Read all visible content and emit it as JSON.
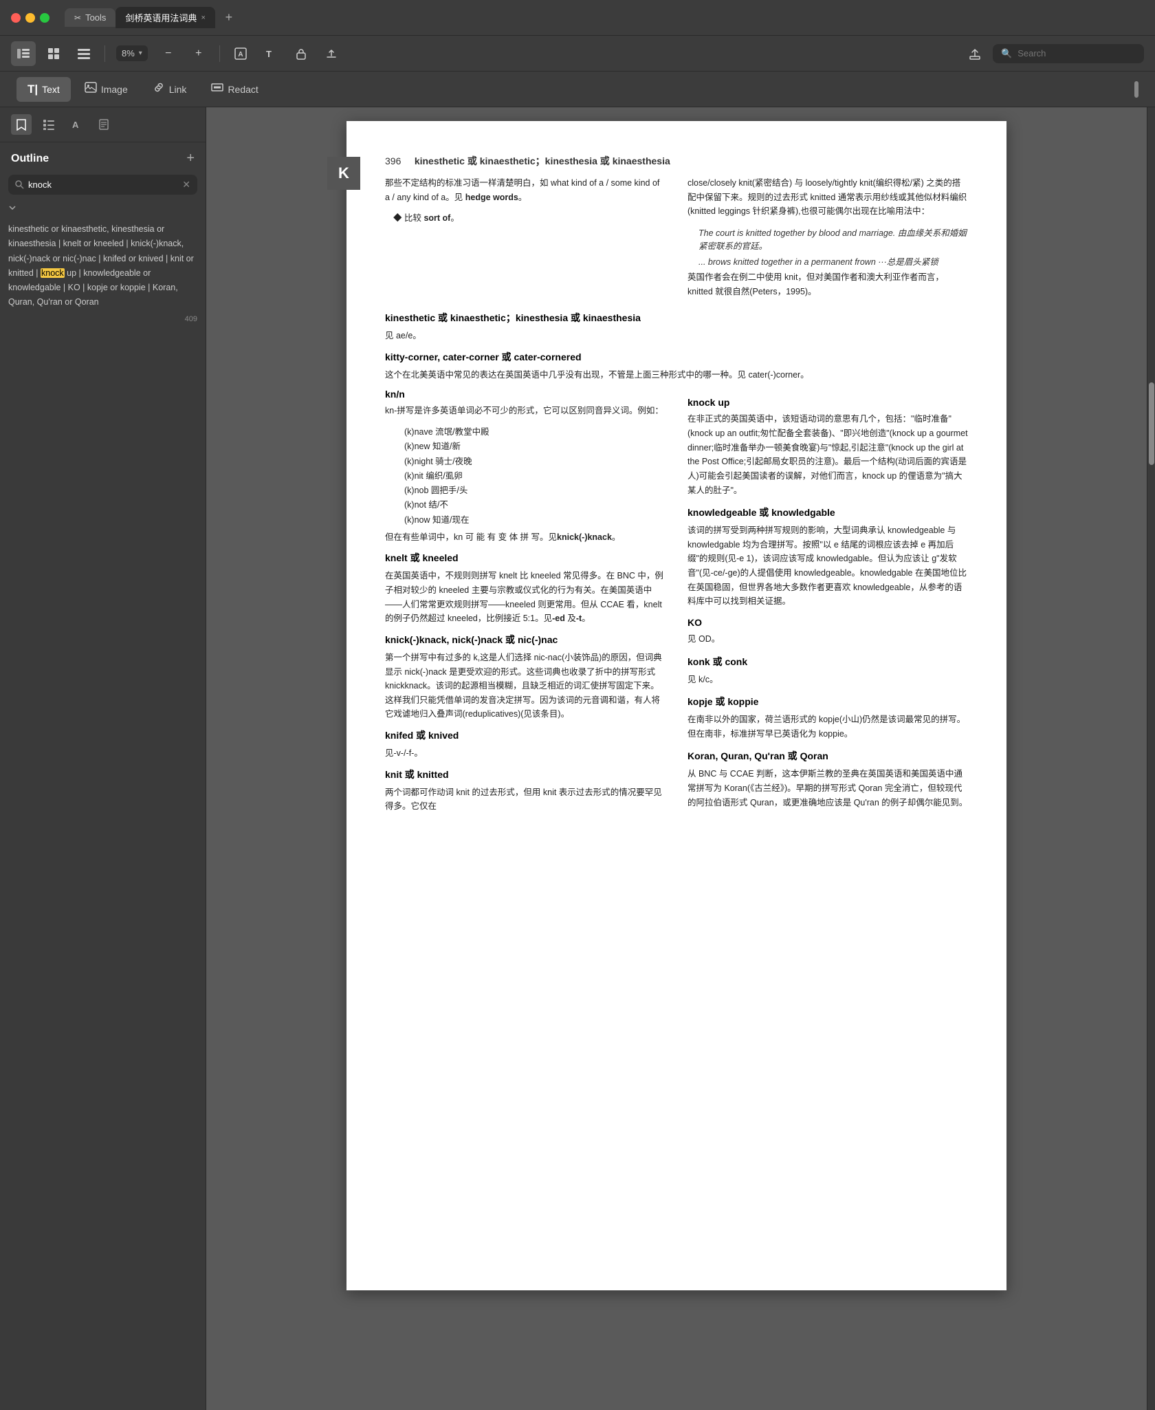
{
  "window": {
    "title": "剑桥英语用法词典",
    "tools_tab": "Tools",
    "close_btn": "×",
    "add_tab": "+"
  },
  "toolbar": {
    "zoom_value": "8%",
    "search_placeholder": "Search",
    "zoom_minus": "−",
    "zoom_plus": "+"
  },
  "toolbar2": {
    "text_label": "Text",
    "image_label": "Image",
    "link_label": "Link",
    "redact_label": "Redact"
  },
  "sidebar": {
    "title": "Outline",
    "search_placeholder": "knock",
    "outline_text": "kinesthetic or kinaesthetic, kinesthesia or kinaesthesia | knelt or kneeled | knick(-)knack, nick(-)nack or nic(-)nac | knifed or knived | knit or knitted | knock up | knowledgeable or knowledgable | KO | kopje or koppie | Koran, Quran, Qu'ran or Qoran",
    "page_num": "409"
  },
  "page": {
    "page_num_heading": "396",
    "section1_title": "kinesthetic 或 kinaesthetic；kinesthesia 或 kinaesthesia",
    "section1_col1_p1": "那些不定结构的标准习语一样清楚明白，如 what kind of a / some kind of a / any kind of a。见 hedge words。",
    "section1_col1_p2": "◆ 比较 sort of。",
    "section1_col2_p1": "close/closely knit(紧密结合) 与 loosely/tightly knit(编织得松/紧) 之类的搭配中保留下来。规则的过去形式 knitted 通常表示用纱线或其他似材料编织(knitted leggings 针织紧身裤),也很可能偶尔出现在比喻用法中：",
    "section1_col2_italic1": "The court is knitted together by blood and marriage. 由血缘关系和婚姻紧密联系的官廷。",
    "section1_col2_italic2": "... brows knitted together in a permanent frown ···总是眉头紧锁",
    "section1_col2_p2": "英国作者会在例二中使用 knit，但对美国作者和澳大利亚作者而言，knitted 就很自然(Peters，1995)。",
    "section2_title": "kinesthetic 或 kinaesthetic；kinesthesia 或 kinaesthesia",
    "section2_sub": "见 ae/e。",
    "section3_title": "kitty-corner, cater-corner 或 cater-cornered",
    "section3_body": "这个在北美英语中常见的表达在英国英语中几乎没有出现，不管是上面三种形式中的哪一种。见 cater(-)corner。",
    "section4_title": "kn/n",
    "section4_p1": "kn-拼写是许多英语单词必不可少的形式，它可以区别同音异义词。例如：",
    "kn_list": [
      "(k)nave 流氓/教堂中殿",
      "(k)new 知道/新",
      "(k)night 骑士/夜晚",
      "(k)nit 编织/虱卵",
      "(k)nob 圆把手/头",
      "(k)not 结/不",
      "(k)now 知道/现在"
    ],
    "section4_p2": "但在有些单词中，kn 可能有变体拼写。见knick(-)knack。",
    "section5_title": "knelt 或 kneeled",
    "section5_body": "在英国英语中，不规则则拼写 knelt 比 kneeled 常见得多。在 BNC 中，例子相对较少的 kneeled 主要与宗教或仪式化的行为有关。在美国英语中——人们常常更欢规则拼写——kneeled 则更常用。但从 CCAE 看，knelt 的例子仍然超过 kneeled，比例接近 5:1。见-ed 及-t。",
    "section6_title": "knick(-)knack, nick(-)nack 或 nic(-)nac",
    "section6_body": "第一个拼写中有过多的 k,这是人们选择 nic-nac(小装饰品)的原因，但词典显示 nick(-)nack 是更受欢迎的形式。这些词典也收录了折中的拼写形式 knickknack。该词的起源相当模糊，且缺乏相近的词汇使拼写固定下来。这样我们只能凭借单词的发音决定拼写。因为该词的元音调和谐，有人将它戏谑地归入叠声词(reduplicatives)(见该条目)。",
    "section7_title": "knifed 或 knived",
    "section7_body": "见-v-/-f-。",
    "section8_title": "knit 或 knitted",
    "section8_body": "两个词都可作动词 knit 的过去形式，但用 knit 表示过去形式的情况要罕见得多。它仅在",
    "section_right_knockup_title": "knock up",
    "section_right_knockup_body": "在非正式的英国英语中，该短语动词的意思有几个，包括：\"临时准备\"(knock up an outfit;匆忙配备全套装备)、\"即兴地创造\"(knock up a gourmet dinner;临时准备举办一顿美食晚宴)与\"惊起,引起注意\"(knock up the girl at the Post Office;引起邮局女职员的注意)。最后一个结构(动词后面的宾语是人)可能会引起美国读者的误解，对他们而言，knock up 的俚语意为\"搞大某人的肚子\"。",
    "section_right_knowledgeable_title": "knowledgeable 或 knowledgable",
    "section_right_knowledgeable_body": "该词的拼写受到两种拼写规则的影响，大型词典承认 knowledgeable 与 knowledgable 均为合理拼写。按照\"以 e 结尾的词根应该去掉 e 再加后缀\"的规则(见-e 1)，该词应该写成 knowledgable。但认为应该让 g\"发软音\"(见-ce/-ge)的人提倡使用 knowledgeable。knowledgable 在美国地位比在英国稳固，但世界各地大多数作者更喜欢 knowledgeable，从参考的语料库中可以找到相关证据。",
    "section_right_ko_title": "KO",
    "section_right_ko_body": "见 OD。",
    "section_right_konk_title": "konk 或 conk",
    "section_right_konk_body": "见 k/c。",
    "section_right_kopje_title": "kopje 或 koppie",
    "section_right_kopje_body": "在南非以外的国家，荷兰语形式的 kopje(小山)仍然是该词最常见的拼写。但在南非，标准拼写早已英语化为 koppie。",
    "section_right_koran_title": "Koran, Quran, Qu'ran 或 Qoran",
    "section_right_koran_body": "从 BNC 与 CCAE 判断，这本伊斯兰教的圣典在英国英语和美国英语中通常拼写为 Koran(《古兰经》)。早期的拼写形式 Qoran 完全消亡，但较现代的阿拉伯语形式 Quran，或更准确地应该是 Qu'ran 的例子却偶尔能见到。"
  },
  "scrollbar": {
    "position": "middle"
  }
}
